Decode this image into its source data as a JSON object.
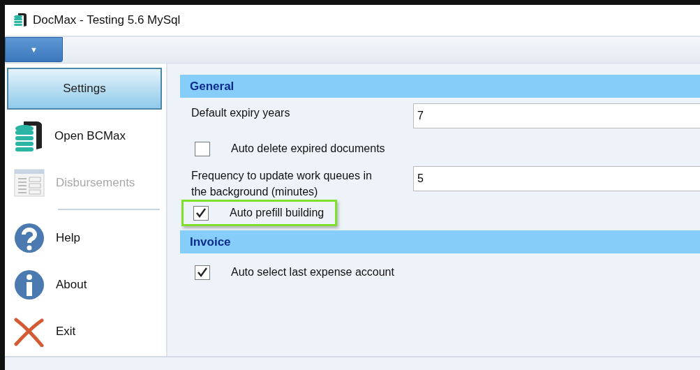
{
  "window": {
    "title": "DocMax - Testing 5.6 MySql"
  },
  "ribbon": {
    "menu_button": "▼"
  },
  "sidebar": {
    "items": [
      {
        "kind": "button",
        "label": "Settings",
        "selected": true,
        "disabled": false
      },
      {
        "kind": "item",
        "label": "Open BCMax",
        "selected": false,
        "disabled": false
      },
      {
        "kind": "item",
        "label": "Disbursements",
        "selected": false,
        "disabled": true
      },
      {
        "kind": "separator"
      },
      {
        "kind": "item",
        "label": "Help",
        "selected": false,
        "disabled": false
      },
      {
        "kind": "item",
        "label": "About",
        "selected": false,
        "disabled": false
      },
      {
        "kind": "item",
        "label": "Exit",
        "selected": false,
        "disabled": false
      }
    ]
  },
  "sections": [
    {
      "title": "General",
      "rows": [
        {
          "kind": "field",
          "label": "Default expiry years",
          "value": "7"
        },
        {
          "kind": "checkbox",
          "label": "Auto delete expired documents",
          "checked": false,
          "highlighted": false
        },
        {
          "kind": "field",
          "label": "Frequency to update work queues in the background (minutes)",
          "value": "5"
        },
        {
          "kind": "checkbox",
          "label": "Auto prefill building",
          "checked": true,
          "highlighted": true
        }
      ]
    },
    {
      "title": "Invoice",
      "rows": [
        {
          "kind": "checkbox",
          "label": "Auto select last expense account",
          "checked": true,
          "highlighted": false
        }
      ]
    }
  ]
}
